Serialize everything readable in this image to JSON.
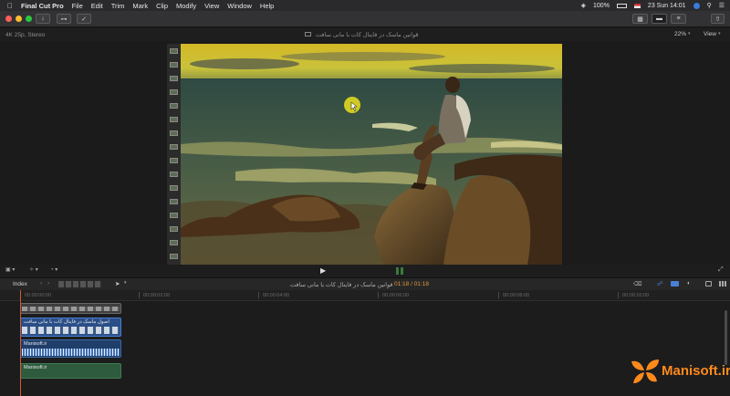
{
  "menubar": {
    "apple_icon": "apple-logo",
    "app_name": "Final Cut Pro",
    "items": [
      "File",
      "Edit",
      "Trim",
      "Mark",
      "Clip",
      "Modify",
      "View",
      "Window",
      "Help"
    ],
    "status": {
      "battery": "100%",
      "datetime": "23 Sun 14:01"
    }
  },
  "viewer": {
    "format_info": "4K 25p, Stereo",
    "clip_title": "قوانین ماسک در فاینال کات با مانی سافت",
    "zoom": "22%",
    "view_menu": "View"
  },
  "timeline": {
    "index_label": "Index",
    "project_title": "قوانین ماسک در فاینال کات با مانی سافت",
    "timecode": "01:18 / 01:18",
    "ruler_ticks": [
      "00:00:00:00",
      "00:00:02:00",
      "00:00:04:00",
      "00:00:06:00",
      "00:00:08:00",
      "00:00:10:00"
    ],
    "clips": {
      "top_label": "",
      "video_label": "اصول ماسک در فاینال کات با مانی سافت",
      "audio_label": "Manisoft.ir",
      "green_label": "Manisoft.ir"
    }
  },
  "watermark": {
    "text": "Manisoft.ir",
    "color": "#ff8a1c"
  },
  "colors": {
    "accent_blue": "#4a7fd6",
    "playhead": "#d65a2a"
  }
}
